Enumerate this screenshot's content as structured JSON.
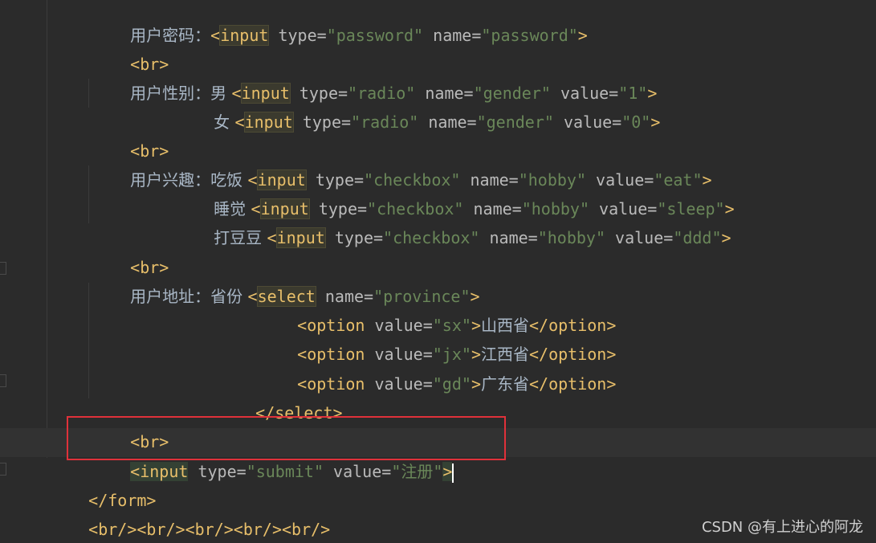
{
  "lines": {
    "l0": {
      "text": "用户密码：",
      "tag_open": "<",
      "el": "input",
      "rest1": " type=",
      "v1": "\"password\"",
      "rest2": " name=",
      "v2": "\"password\"",
      "close": ">"
    },
    "l1": {
      "tag": "<br>"
    },
    "l2": {
      "text": "用户性别：男 ",
      "tag_open": "<",
      "el": "input",
      "a1": " type=",
      "v1": "\"radio\"",
      "a2": " name=",
      "v2": "\"gender\"",
      "a3": " value=",
      "v3": "\"1\"",
      "close": ">"
    },
    "l3": {
      "text": "女 ",
      "tag_open": "<",
      "el": "input",
      "a1": " type=",
      "v1": "\"radio\"",
      "a2": " name=",
      "v2": "\"gender\"",
      "a3": " value=",
      "v3": "\"0\"",
      "close": ">"
    },
    "l4": {
      "tag": "<br>"
    },
    "l5": {
      "text": "用户兴趣：吃饭 ",
      "tag_open": "<",
      "el": "input",
      "a1": " type=",
      "v1": "\"checkbox\"",
      "a2": " name=",
      "v2": "\"hobby\"",
      "a3": " value=",
      "v3": "\"eat\"",
      "close": ">"
    },
    "l6": {
      "text": "睡觉 ",
      "tag_open": "<",
      "el": "input",
      "a1": " type=",
      "v1": "\"checkbox\"",
      "a2": " name=",
      "v2": "\"hobby\"",
      "a3": " value=",
      "v3": "\"sleep\"",
      "close": ">"
    },
    "l7": {
      "text": "打豆豆 ",
      "tag_open": "<",
      "el": "input",
      "a1": " type=",
      "v1": "\"checkbox\"",
      "a2": " name=",
      "v2": "\"hobby\"",
      "a3": " value=",
      "v3": "\"ddd\"",
      "close": ">"
    },
    "l8": {
      "tag": "<br>"
    },
    "l9": {
      "text": "用户地址：省份 ",
      "tag_open": "<",
      "el": "select",
      "a1": " name=",
      "v1": "\"province\"",
      "close": ">"
    },
    "l10": {
      "open": "<option",
      "a1": " value=",
      "v1": "\"sx\"",
      "gt": ">",
      "text": "山西省",
      "end": "</option>"
    },
    "l11": {
      "open": "<option",
      "a1": " value=",
      "v1": "\"jx\"",
      "gt": ">",
      "text": "江西省",
      "end": "</option>"
    },
    "l12": {
      "open": "<option",
      "a1": " value=",
      "v1": "\"gd\"",
      "gt": ">",
      "text": "广东省",
      "end": "</option>"
    },
    "l13": {
      "tag": "</select>"
    },
    "l14": {
      "tag": "<br>"
    },
    "l15": {
      "tag_open": "<",
      "el": "input",
      "a1": " type=",
      "v1": "\"submit\"",
      "a2": " value=",
      "v2": "\"注册\"",
      "close": ">"
    },
    "l16": {
      "tag": "</form>"
    },
    "l17": {
      "tag": "<br/><br/><br/><br/><br/>"
    }
  },
  "watermark": "CSDN @有上进心的阿龙"
}
